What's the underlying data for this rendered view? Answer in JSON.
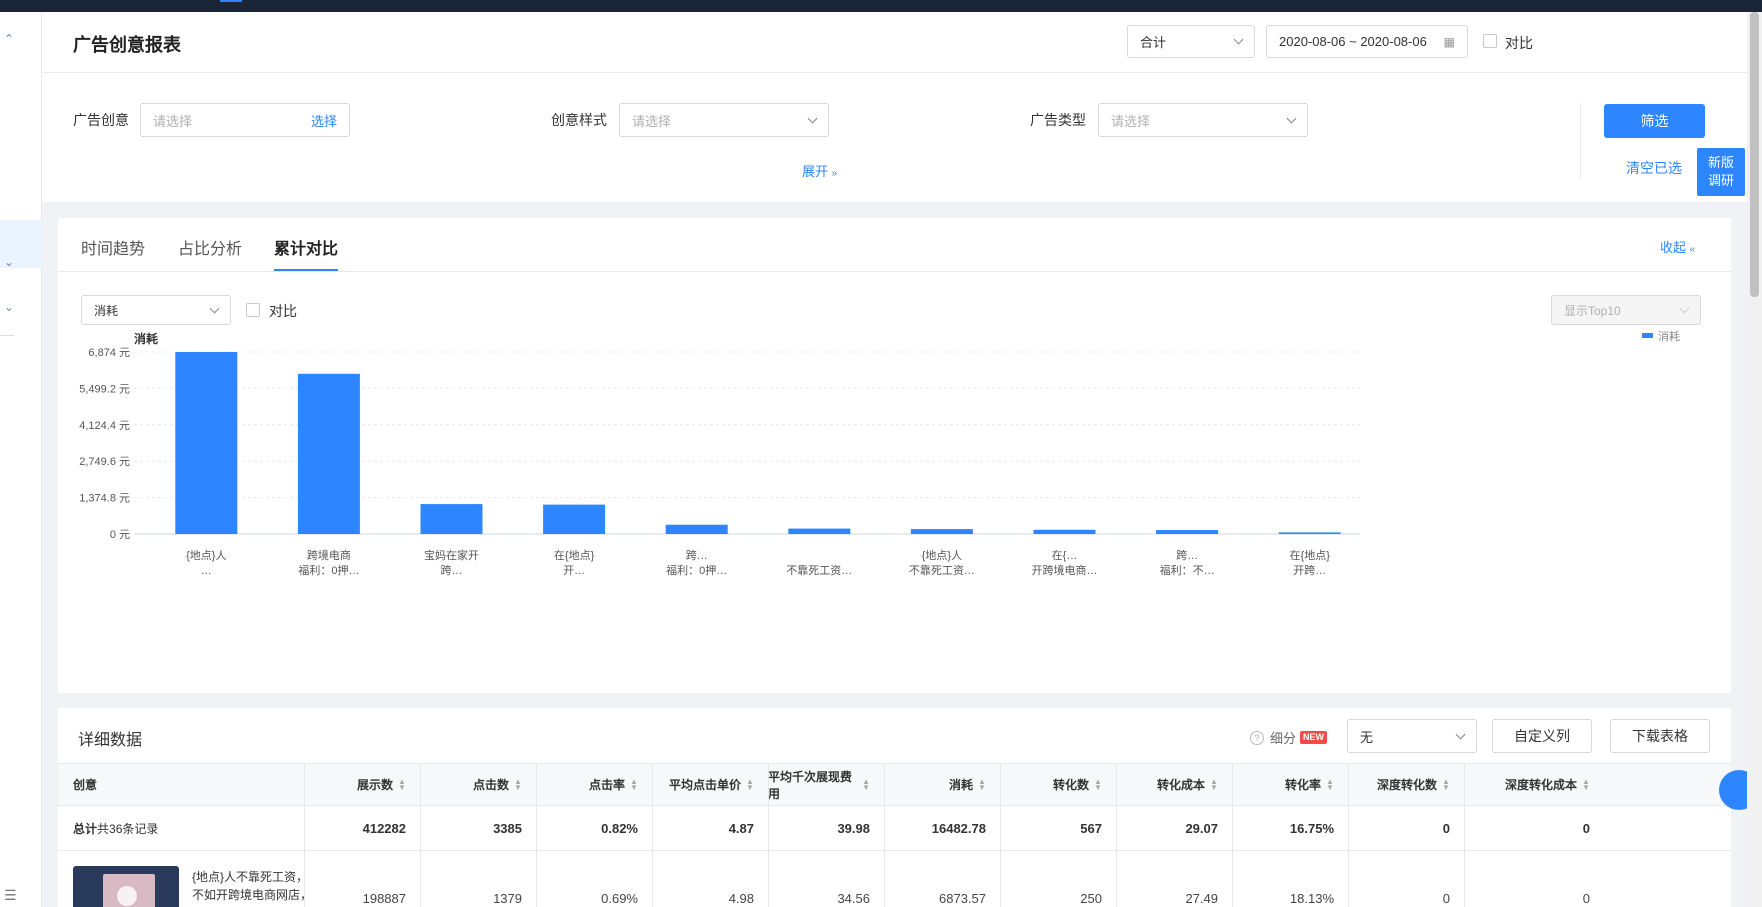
{
  "header": {
    "title": "广告创意报表",
    "aggregate": "合计",
    "date_range": "2020-08-06 ~ 2020-08-06",
    "compare_label": "对比"
  },
  "filters": {
    "creative_label": "广告创意",
    "creative_placeholder": "请选择",
    "creative_select": "选择",
    "style_label": "创意样式",
    "style_placeholder": "请选择",
    "type_label": "广告类型",
    "type_placeholder": "请选择",
    "expand": "展开",
    "filter_button": "筛选",
    "clear": "清空已选",
    "survey": "新版调研"
  },
  "chart_panel": {
    "tabs": [
      "时间趋势",
      "占比分析",
      "累计对比"
    ],
    "active_tab": 2,
    "collapse": "收起",
    "metric": "消耗",
    "compare_label": "对比",
    "top_select": "显示Top10"
  },
  "chart_data": {
    "type": "bar",
    "ylabel": "消耗",
    "legend": "消耗",
    "legend_position": "top-right",
    "y_ticks": [
      "0 元",
      "1,374.8 元",
      "2,749.6 元",
      "4,124.4 元",
      "5,499.2 元",
      "6,874 元"
    ],
    "ylim": [
      0,
      6874
    ],
    "grid": true,
    "categories": [
      {
        "line1": "{地点}人",
        "line2": "…"
      },
      {
        "line1": "跨境电商",
        "line2": "福利：0押…"
      },
      {
        "line1": "宝妈在家开",
        "line2": "跨…"
      },
      {
        "line1": "在{地点}",
        "line2": "开…"
      },
      {
        "line1": "跨…",
        "line2": "福利：0押…"
      },
      {
        "line1": "",
        "line2": "不靠死工资…"
      },
      {
        "line1": "{地点}人",
        "line2": "不靠死工资…"
      },
      {
        "line1": "在{…",
        "line2": "开跨境电商…"
      },
      {
        "line1": "跨…",
        "line2": "福利：不…"
      },
      {
        "line1": "在{地点}",
        "line2": "开跨…"
      }
    ],
    "values": [
      6874,
      6050,
      1130,
      1110,
      350,
      205,
      185,
      160,
      150,
      60
    ],
    "color": "#2d86ff"
  },
  "table": {
    "title": "详细数据",
    "breakdown_label": "细分",
    "new_badge": "NEW",
    "breakdown_value": "无",
    "custom_columns": "自定义列",
    "download": "下载表格",
    "columns": [
      "创意",
      "展示数",
      "点击数",
      "点击率",
      "平均点击单价",
      "平均千次展现费用",
      "消耗",
      "转化数",
      "转化成本",
      "转化率",
      "深度转化数",
      "深度转化成本"
    ],
    "total_label": "总计",
    "total_count": "共36条记录",
    "total_row": [
      "412282",
      "3385",
      "0.82%",
      "4.87",
      "39.98",
      "16482.78",
      "567",
      "29.07",
      "16.75%",
      "0",
      "0"
    ],
    "row1_text_line1": "{地点}人不靠死工资，",
    "row1_text_line2": "不如开跨境电商网店，",
    "row1_values": [
      "198887",
      "1379",
      "0.69%",
      "4.98",
      "34.56",
      "6873.57",
      "250",
      "27.49",
      "18.13%",
      "0",
      "0"
    ]
  }
}
